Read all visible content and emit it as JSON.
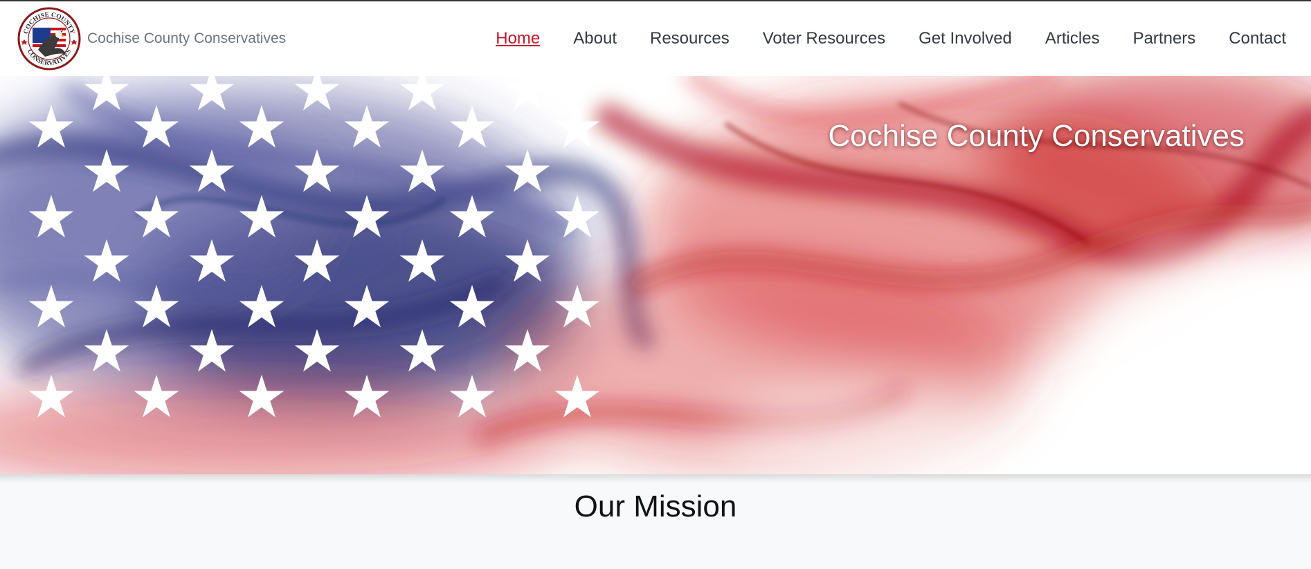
{
  "site": {
    "name": "Cochise County Conservatives",
    "logo": {
      "top_text": "COCHISE COUNTY",
      "bottom_text": "CONSERVATIVES",
      "icon": "eagle-flag-seal"
    }
  },
  "nav": {
    "items": [
      {
        "label": "Home",
        "active": true
      },
      {
        "label": "About",
        "active": false
      },
      {
        "label": "Resources",
        "active": false
      },
      {
        "label": "Voter Resources",
        "active": false
      },
      {
        "label": "Get Involved",
        "active": false
      },
      {
        "label": "Articles",
        "active": false
      },
      {
        "label": "Partners",
        "active": false
      },
      {
        "label": "Contact",
        "active": false
      }
    ]
  },
  "hero": {
    "title": "Cochise County Conservatives",
    "image": "smoke-american-flag",
    "colors": {
      "blue": "#2c2f7a",
      "red": "#c8141c",
      "star": "#ffffff"
    }
  },
  "mission": {
    "heading": "Our Mission"
  },
  "colors": {
    "accent": "#c0162c",
    "nav_text": "#343a40",
    "brand_text": "#6c757d",
    "page_bg": "#f8f9fa"
  }
}
